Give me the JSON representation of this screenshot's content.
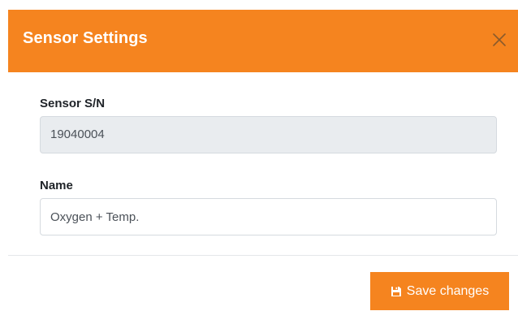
{
  "modal": {
    "title": "Sensor Settings",
    "close_icon": "close-icon",
    "header_color": "#f5841f"
  },
  "fields": {
    "serial": {
      "label": "Sensor S/N",
      "value": "19040004",
      "readonly": true
    },
    "name": {
      "label": "Name",
      "value": "Oxygen + Temp."
    }
  },
  "footer": {
    "save_label": "Save changes",
    "save_icon": "floppy-disk-icon",
    "save_color": "#f5841f"
  }
}
